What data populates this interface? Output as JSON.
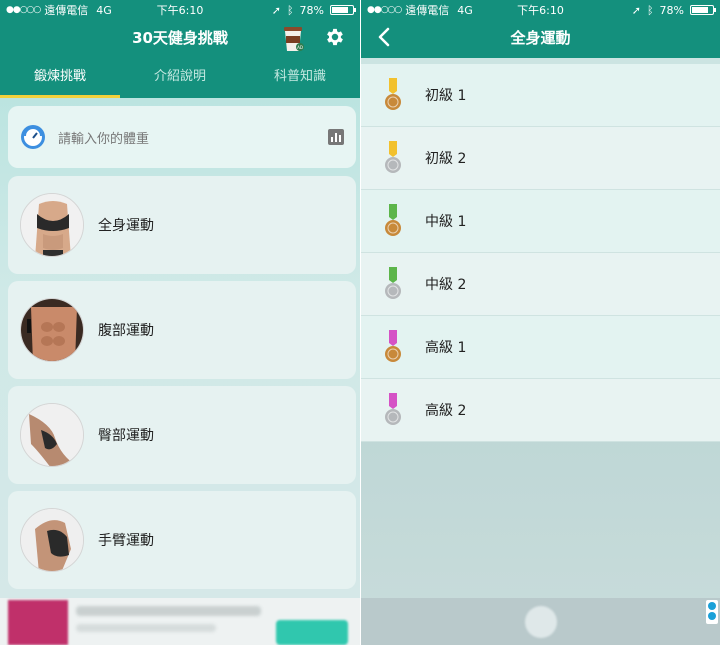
{
  "status_bar": {
    "signal": "●●○○○",
    "carrier": "遠傳電信",
    "network": "4G",
    "time": "下午6:10",
    "battery_percent": "78%",
    "battery_level": 0.78
  },
  "left_screen": {
    "title": "30天健身挑戰",
    "tabs": [
      {
        "label": "鍛煉挑戰",
        "active": true
      },
      {
        "label": "介紹說明",
        "active": false
      },
      {
        "label": "科普知識",
        "active": false
      }
    ],
    "weight_input": {
      "placeholder": "請輸入你的體重"
    },
    "exercises": [
      {
        "label": "全身運動"
      },
      {
        "label": "腹部運動"
      },
      {
        "label": "臀部運動"
      },
      {
        "label": "手臂運動"
      }
    ]
  },
  "right_screen": {
    "title": "全身運動",
    "levels": [
      {
        "label": "初級 1",
        "ribbon_color": "#f2c12e",
        "medal": "bronze"
      },
      {
        "label": "初級 2",
        "ribbon_color": "#f2c12e",
        "medal": "silver"
      },
      {
        "label": "中級 1",
        "ribbon_color": "#5cb54a",
        "medal": "bronze"
      },
      {
        "label": "中級 2",
        "ribbon_color": "#5cb54a",
        "medal": "silver"
      },
      {
        "label": "高級 1",
        "ribbon_color": "#d552c6",
        "medal": "bronze"
      },
      {
        "label": "高級 2",
        "ribbon_color": "#d552c6",
        "medal": "silver"
      }
    ]
  },
  "colors": {
    "primary": "#14907d",
    "tab_indicator": "#f2d13a",
    "bronze": "#c8893a",
    "silver": "#b5b8bb"
  }
}
